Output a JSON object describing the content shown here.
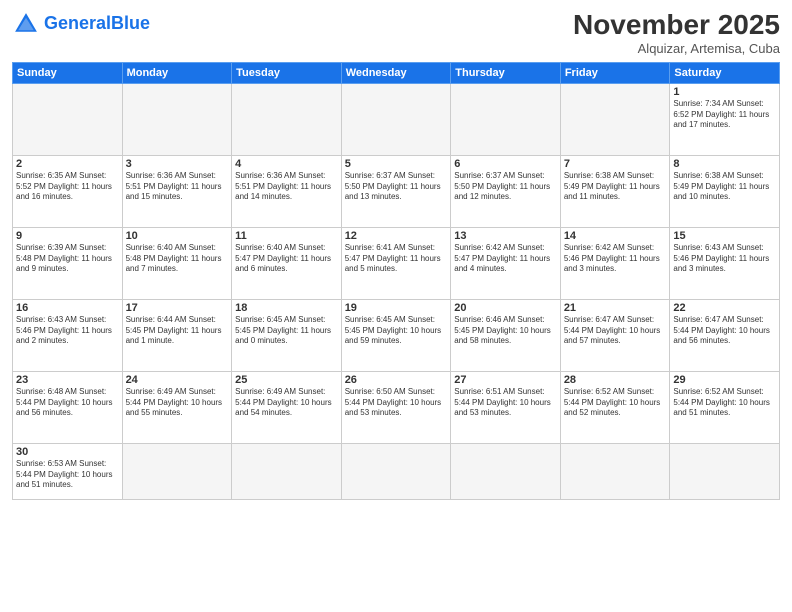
{
  "logo": {
    "text_general": "General",
    "text_blue": "Blue"
  },
  "header": {
    "month_title": "November 2025",
    "subtitle": "Alquizar, Artemisa, Cuba"
  },
  "days_of_week": [
    "Sunday",
    "Monday",
    "Tuesday",
    "Wednesday",
    "Thursday",
    "Friday",
    "Saturday"
  ],
  "weeks": [
    [
      {
        "day": "",
        "info": ""
      },
      {
        "day": "",
        "info": ""
      },
      {
        "day": "",
        "info": ""
      },
      {
        "day": "",
        "info": ""
      },
      {
        "day": "",
        "info": ""
      },
      {
        "day": "",
        "info": ""
      },
      {
        "day": "1",
        "info": "Sunrise: 7:34 AM\nSunset: 6:52 PM\nDaylight: 11 hours\nand 17 minutes."
      }
    ],
    [
      {
        "day": "2",
        "info": "Sunrise: 6:35 AM\nSunset: 5:52 PM\nDaylight: 11 hours\nand 16 minutes."
      },
      {
        "day": "3",
        "info": "Sunrise: 6:36 AM\nSunset: 5:51 PM\nDaylight: 11 hours\nand 15 minutes."
      },
      {
        "day": "4",
        "info": "Sunrise: 6:36 AM\nSunset: 5:51 PM\nDaylight: 11 hours\nand 14 minutes."
      },
      {
        "day": "5",
        "info": "Sunrise: 6:37 AM\nSunset: 5:50 PM\nDaylight: 11 hours\nand 13 minutes."
      },
      {
        "day": "6",
        "info": "Sunrise: 6:37 AM\nSunset: 5:50 PM\nDaylight: 11 hours\nand 12 minutes."
      },
      {
        "day": "7",
        "info": "Sunrise: 6:38 AM\nSunset: 5:49 PM\nDaylight: 11 hours\nand 11 minutes."
      },
      {
        "day": "8",
        "info": "Sunrise: 6:38 AM\nSunset: 5:49 PM\nDaylight: 11 hours\nand 10 minutes."
      }
    ],
    [
      {
        "day": "9",
        "info": "Sunrise: 6:39 AM\nSunset: 5:48 PM\nDaylight: 11 hours\nand 9 minutes."
      },
      {
        "day": "10",
        "info": "Sunrise: 6:40 AM\nSunset: 5:48 PM\nDaylight: 11 hours\nand 7 minutes."
      },
      {
        "day": "11",
        "info": "Sunrise: 6:40 AM\nSunset: 5:47 PM\nDaylight: 11 hours\nand 6 minutes."
      },
      {
        "day": "12",
        "info": "Sunrise: 6:41 AM\nSunset: 5:47 PM\nDaylight: 11 hours\nand 5 minutes."
      },
      {
        "day": "13",
        "info": "Sunrise: 6:42 AM\nSunset: 5:47 PM\nDaylight: 11 hours\nand 4 minutes."
      },
      {
        "day": "14",
        "info": "Sunrise: 6:42 AM\nSunset: 5:46 PM\nDaylight: 11 hours\nand 3 minutes."
      },
      {
        "day": "15",
        "info": "Sunrise: 6:43 AM\nSunset: 5:46 PM\nDaylight: 11 hours\nand 3 minutes."
      }
    ],
    [
      {
        "day": "16",
        "info": "Sunrise: 6:43 AM\nSunset: 5:46 PM\nDaylight: 11 hours\nand 2 minutes."
      },
      {
        "day": "17",
        "info": "Sunrise: 6:44 AM\nSunset: 5:45 PM\nDaylight: 11 hours\nand 1 minute."
      },
      {
        "day": "18",
        "info": "Sunrise: 6:45 AM\nSunset: 5:45 PM\nDaylight: 11 hours\nand 0 minutes."
      },
      {
        "day": "19",
        "info": "Sunrise: 6:45 AM\nSunset: 5:45 PM\nDaylight: 10 hours\nand 59 minutes."
      },
      {
        "day": "20",
        "info": "Sunrise: 6:46 AM\nSunset: 5:45 PM\nDaylight: 10 hours\nand 58 minutes."
      },
      {
        "day": "21",
        "info": "Sunrise: 6:47 AM\nSunset: 5:44 PM\nDaylight: 10 hours\nand 57 minutes."
      },
      {
        "day": "22",
        "info": "Sunrise: 6:47 AM\nSunset: 5:44 PM\nDaylight: 10 hours\nand 56 minutes."
      }
    ],
    [
      {
        "day": "23",
        "info": "Sunrise: 6:48 AM\nSunset: 5:44 PM\nDaylight: 10 hours\nand 56 minutes."
      },
      {
        "day": "24",
        "info": "Sunrise: 6:49 AM\nSunset: 5:44 PM\nDaylight: 10 hours\nand 55 minutes."
      },
      {
        "day": "25",
        "info": "Sunrise: 6:49 AM\nSunset: 5:44 PM\nDaylight: 10 hours\nand 54 minutes."
      },
      {
        "day": "26",
        "info": "Sunrise: 6:50 AM\nSunset: 5:44 PM\nDaylight: 10 hours\nand 53 minutes."
      },
      {
        "day": "27",
        "info": "Sunrise: 6:51 AM\nSunset: 5:44 PM\nDaylight: 10 hours\nand 53 minutes."
      },
      {
        "day": "28",
        "info": "Sunrise: 6:52 AM\nSunset: 5:44 PM\nDaylight: 10 hours\nand 52 minutes."
      },
      {
        "day": "29",
        "info": "Sunrise: 6:52 AM\nSunset: 5:44 PM\nDaylight: 10 hours\nand 51 minutes."
      }
    ],
    [
      {
        "day": "30",
        "info": "Sunrise: 6:53 AM\nSunset: 5:44 PM\nDaylight: 10 hours\nand 51 minutes."
      },
      {
        "day": "",
        "info": ""
      },
      {
        "day": "",
        "info": ""
      },
      {
        "day": "",
        "info": ""
      },
      {
        "day": "",
        "info": ""
      },
      {
        "day": "",
        "info": ""
      },
      {
        "day": "",
        "info": ""
      }
    ]
  ]
}
